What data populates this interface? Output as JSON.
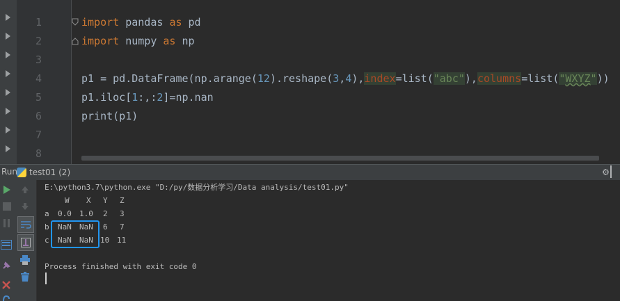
{
  "editor": {
    "line_numbers": [
      "1",
      "2",
      "3",
      "4",
      "5",
      "6",
      "7",
      "8"
    ],
    "lines": [
      [
        {
          "t": "import",
          "c": "kw"
        },
        {
          "t": " pandas ",
          "c": ""
        },
        {
          "t": "as",
          "c": "kw"
        },
        {
          "t": " pd",
          "c": ""
        }
      ],
      [
        {
          "t": "import",
          "c": "kw"
        },
        {
          "t": " numpy ",
          "c": ""
        },
        {
          "t": "as",
          "c": "kw"
        },
        {
          "t": " np",
          "c": ""
        }
      ],
      [],
      [
        {
          "t": "p1 = pd.DataFrame(np.arange(",
          "c": ""
        },
        {
          "t": "12",
          "c": "num"
        },
        {
          "t": ").reshape(",
          "c": ""
        },
        {
          "t": "3",
          "c": "num"
        },
        {
          "t": ",",
          "c": ""
        },
        {
          "t": "4",
          "c": "num"
        },
        {
          "t": "),",
          "c": ""
        },
        {
          "t": "index",
          "c": "param hl"
        },
        {
          "t": "=list(",
          "c": ""
        },
        {
          "t": "\"abc\"",
          "c": "str hl"
        },
        {
          "t": "),",
          "c": ""
        },
        {
          "t": "columns",
          "c": "param hl"
        },
        {
          "t": "=list(",
          "c": ""
        },
        {
          "t": "\"",
          "c": "str hl"
        },
        {
          "t": "WXYZ",
          "c": "str hl underline"
        },
        {
          "t": "\"",
          "c": "str hl"
        },
        {
          "t": "))",
          "c": ""
        }
      ],
      [
        {
          "t": "p1.iloc[",
          "c": ""
        },
        {
          "t": "1",
          "c": "num"
        },
        {
          "t": ":,:",
          "c": ""
        },
        {
          "t": "2",
          "c": "num"
        },
        {
          "t": "]=np.nan",
          "c": ""
        }
      ],
      [
        {
          "t": "print(p1)",
          "c": ""
        }
      ],
      [],
      []
    ]
  },
  "run": {
    "title": "Run",
    "tab_label": "test01 (2)"
  },
  "console": {
    "command": "E:\\python3.7\\python.exe \"D:/py/数据分析学习/Data analysis/test01.py\"",
    "table": {
      "columns": [
        "W",
        "X",
        "Y",
        "Z"
      ],
      "rows": [
        {
          "index": "a",
          "cells": [
            "0.0",
            "1.0",
            "2",
            "3"
          ]
        },
        {
          "index": "b",
          "cells": [
            "NaN",
            "NaN",
            "6",
            "7"
          ]
        },
        {
          "index": "c",
          "cells": [
            "NaN",
            "NaN",
            "10",
            "11"
          ]
        }
      ]
    },
    "exit_message": "Process finished with exit code 0"
  },
  "colors": {
    "highlight_box": "#2196f3",
    "run_green": "#59a869",
    "stop_red": "#c75450"
  }
}
